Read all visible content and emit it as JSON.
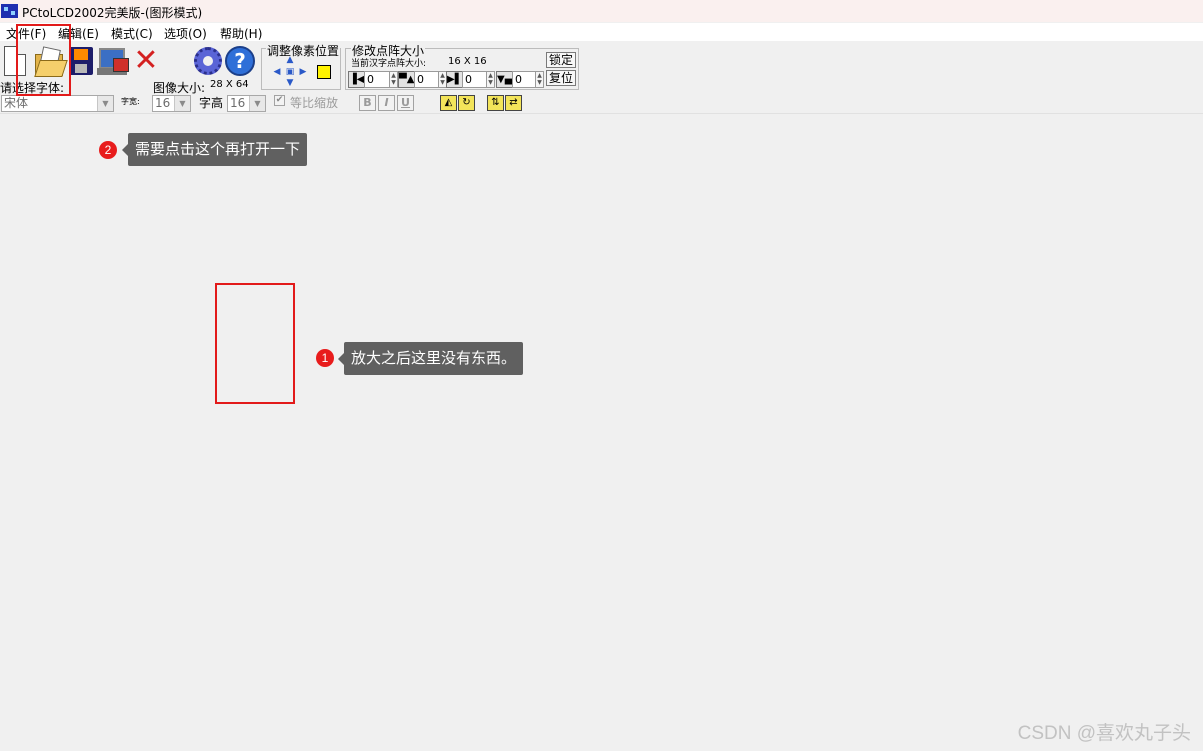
{
  "window": {
    "title": "PCtoLCD2002完美版-(图形模式)"
  },
  "menu": [
    "文件(F)",
    "编辑(E)",
    "模式(C)",
    "选项(O)",
    "帮助(H)"
  ],
  "pixel_adjust": {
    "title": "调整像素位置"
  },
  "dot_size": {
    "title": "修改点阵大小",
    "current_label": "当前汉字点阵大小:",
    "current_size": "16 X 16",
    "lock_button": "锁定",
    "reset_button": "复位",
    "spin_values": [
      "0",
      "0",
      "0",
      "0"
    ]
  },
  "font": {
    "label": "请选择字体:",
    "selected": "宋体"
  },
  "image_size": {
    "label": "图像大小:",
    "value": "28 X 64"
  },
  "char_width": {
    "label": "字宽:",
    "value": "16"
  },
  "char_height": {
    "label": "字高",
    "value": "16"
  },
  "proportional": {
    "label": "等比缩放",
    "checked": true
  },
  "format_buttons": [
    "B",
    "I",
    "U"
  ],
  "annotations": [
    {
      "number": "2",
      "text": "需要点击这个再打开一下"
    },
    {
      "number": "1",
      "text": "放大之后这里没有东西。"
    }
  ],
  "watermark": "CSDN @喜欢丸子头"
}
